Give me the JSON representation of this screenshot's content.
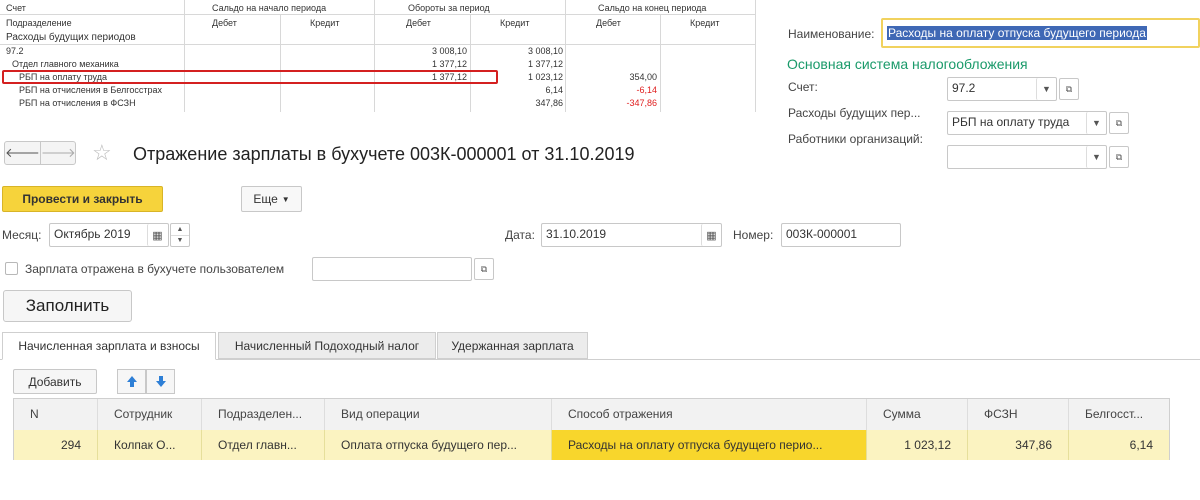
{
  "report": {
    "headers": {
      "account": "Счет",
      "subdivision": "Подразделение",
      "deferred": "Расходы будущих периодов",
      "opening": "Сальдо на начало периода",
      "turnover": "Обороты за период",
      "closing": "Сальдо на конец периода",
      "debit": "Дебет",
      "credit": "Кредит"
    },
    "rows": [
      {
        "label": "97.2",
        "turn_debit": "3 008,10",
        "turn_credit": "3 008,10",
        "close_debit": ""
      },
      {
        "label": "Отдел главного механика",
        "turn_debit": "1 377,12",
        "turn_credit": "1 377,12",
        "close_debit": ""
      },
      {
        "label": "РБП на оплату труда",
        "turn_debit": "1 377,12",
        "turn_credit": "1 023,12",
        "close_debit": "354,00"
      },
      {
        "label": "РБП на отчисления в Белгосстрах",
        "turn_debit": "",
        "turn_credit": "6,14",
        "close_debit": "-6,14"
      },
      {
        "label": "РБП на отчисления в ФСЗН",
        "turn_debit": "",
        "turn_credit": "347,86",
        "close_debit": "-347,86"
      }
    ]
  },
  "right_panel": {
    "name_label": "Наименование:",
    "name_value": "Расходы на оплату отпуска будущего периода",
    "tax_heading": "Основная система налогообложения",
    "account_label": "Счет:",
    "account_value": "97.2",
    "deferred_label": "Расходы будущих пер...",
    "deferred_value": "РБП на оплату труда",
    "employees_label": "Работники организаций:",
    "employees_value": ""
  },
  "document": {
    "title": "Отражение зарплаты в бухучете 003К-000001 от 31.10.2019",
    "post_close_label": "Провести и закрыть",
    "more_label": "Еще",
    "month_label": "Месяц:",
    "month_value": "Октябрь 2019",
    "date_label": "Дата:",
    "date_value": "31.10.2019",
    "number_label": "Номер:",
    "number_value": "003К-000001",
    "checkbox_label": "Зарплата отражена в бухучете пользователем",
    "user_value": "",
    "fill_label": "Заполнить"
  },
  "tabs": [
    {
      "label": "Начисленная зарплата и взносы"
    },
    {
      "label": "Начисленный Подоходный налог"
    },
    {
      "label": "Удержанная зарплата"
    }
  ],
  "table": {
    "add_label": "Добавить",
    "columns": [
      "N",
      "Сотрудник",
      "Подразделен...",
      "Вид операции",
      "Способ отражения",
      "Сумма",
      "ФСЗН",
      "Белгосст..."
    ],
    "row": [
      "294",
      "Колпак О...",
      "Отдел главн...",
      "Оплата отпуска будущего пер...",
      "Расходы на оплату отпуска будущего перио...",
      "1 023,12",
      "347,86",
      "6,14"
    ]
  },
  "colors": {
    "accent_yellow": "#f6d33b",
    "tax_heading": "#1a9a6a",
    "highlight_red": "#d42020",
    "row_highlight": "#fbf3c1",
    "selection_blue": "#3f68b5"
  }
}
